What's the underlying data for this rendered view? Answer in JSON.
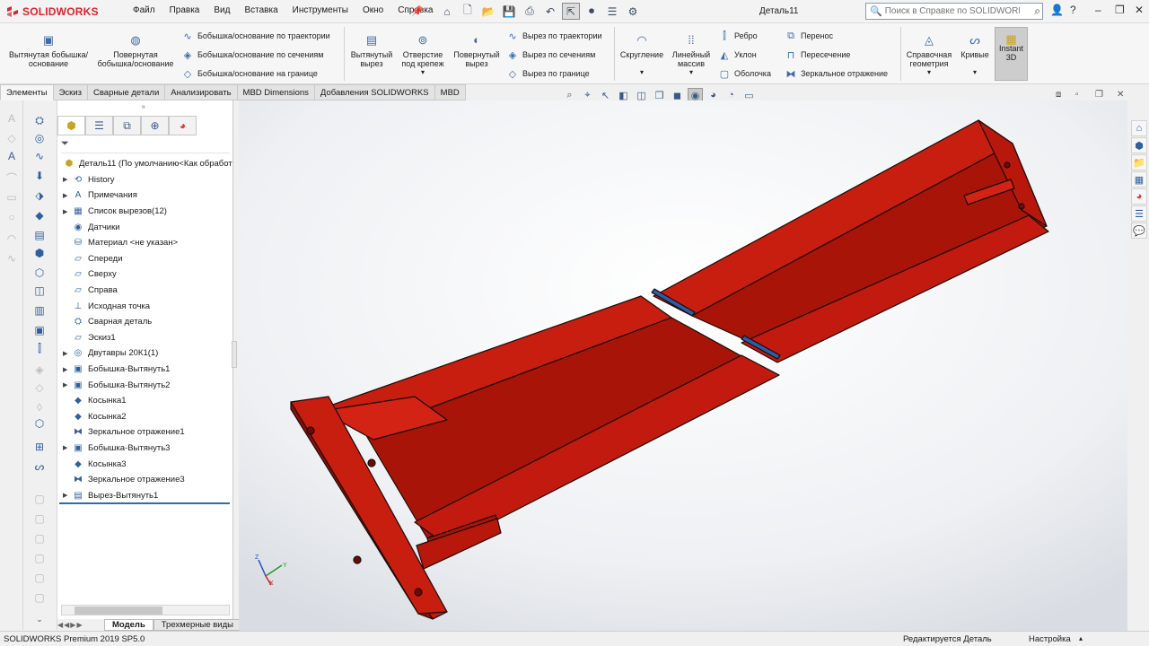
{
  "app": {
    "name": "SOLIDWORKS",
    "document_title": "Деталь11"
  },
  "colors": {
    "brand": "#d6262f",
    "part": "#c21a0e",
    "accent": "#2a6db5"
  },
  "menu": [
    "Файл",
    "Правка",
    "Вид",
    "Вставка",
    "Инструменты",
    "Окно",
    "Справка"
  ],
  "search": {
    "placeholder": "Поиск в Справке по SOLIDWORKS"
  },
  "commands": {
    "extrude_boss": "Вытянутая бобышка/основание",
    "revolve_boss": "Повернутая бобышка/основание",
    "swept_boss": "Бобышка/основание по траектории",
    "lofted_boss": "Бобышка/основание по сечениям",
    "boundary_boss": "Бобышка/основание на границе",
    "extruded_cut": "Вытянутый вырез",
    "hole_wizard": "Отверстие под крепеж",
    "revolved_cut": "Повернутый вырез",
    "swept_cut": "Вырез по траектории",
    "lofted_cut": "Вырез по сечениям",
    "boundary_cut": "Вырез по границе",
    "fillet": "Скругление",
    "linear_pattern": "Линейный массив",
    "rib": "Ребро",
    "draft": "Уклон",
    "shell": "Оболочка",
    "wrap": "Перенос",
    "intersect": "Пересечение",
    "mirror": "Зеркальное отражение",
    "reference_geometry": "Справочная геометрия",
    "curves": "Кривые",
    "instant3d": "Instant 3D"
  },
  "tabs": [
    "Элементы",
    "Эскиз",
    "Сварные детали",
    "Анализировать",
    "MBD Dimensions",
    "Добавления SOLIDWORKS",
    "MBD"
  ],
  "feature_tree": [
    {
      "label": "Деталь11  (По умолчанию<Как обработ",
      "icon": "part-icon",
      "expand": false,
      "root": true
    },
    {
      "label": "History",
      "icon": "history-icon",
      "expand": true
    },
    {
      "label": "Примечания",
      "icon": "annotations-icon",
      "expand": true
    },
    {
      "label": "Список вырезов(12)",
      "icon": "cut-list-icon",
      "expand": true
    },
    {
      "label": "Датчики",
      "icon": "sensor-icon",
      "expand": false
    },
    {
      "label": "Материал <не указан>",
      "icon": "material-icon",
      "expand": false
    },
    {
      "label": "Спереди",
      "icon": "plane-icon",
      "expand": false
    },
    {
      "label": "Сверху",
      "icon": "plane-icon",
      "expand": false
    },
    {
      "label": "Справа",
      "icon": "plane-icon",
      "expand": false
    },
    {
      "label": "Исходная точка",
      "icon": "origin-icon",
      "expand": false
    },
    {
      "label": "Сварная деталь",
      "icon": "weldment-icon",
      "expand": false
    },
    {
      "label": "Эскиз1",
      "icon": "sketch-icon",
      "expand": false
    },
    {
      "label": "Двутавры 20К1(1)",
      "icon": "structural-member-icon",
      "expand": true
    },
    {
      "label": "Бобышка-Вытянуть1",
      "icon": "extrude-icon",
      "expand": true
    },
    {
      "label": "Бобышка-Вытянуть2",
      "icon": "extrude-icon",
      "expand": true
    },
    {
      "label": "Косынка1",
      "icon": "gusset-icon",
      "expand": false
    },
    {
      "label": "Косынка2",
      "icon": "gusset-icon",
      "expand": false
    },
    {
      "label": "Зеркальное отражение1",
      "icon": "mirror-icon",
      "expand": false
    },
    {
      "label": "Бобышка-Вытянуть3",
      "icon": "extrude-icon",
      "expand": true
    },
    {
      "label": "Косынка3",
      "icon": "gusset-icon",
      "expand": false
    },
    {
      "label": "Зеркальное отражение3",
      "icon": "mirror-icon",
      "expand": false
    },
    {
      "label": "Вырез-Вытянуть1",
      "icon": "cut-extrude-icon",
      "expand": true
    }
  ],
  "bottom_tabs": [
    "Модель",
    "Трехмерные виды"
  ],
  "status": {
    "product": "SOLIDWORKS Premium 2019 SP5.0",
    "mode": "Редактируется Деталь",
    "settings": "Настройка"
  },
  "triad": {
    "x": "X",
    "y": "Y",
    "z": "Z"
  }
}
